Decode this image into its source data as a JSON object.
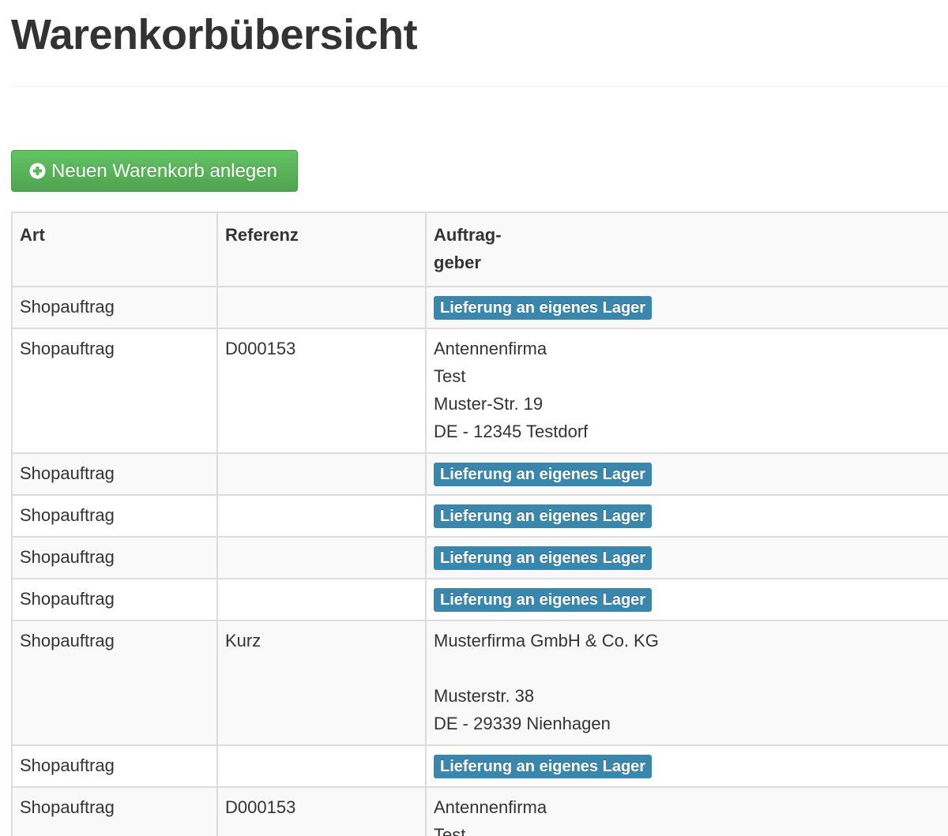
{
  "page": {
    "title": "Warenkorbübersicht"
  },
  "toolbar": {
    "new_cart_label": "Neuen Warenkorb anlegen",
    "new_cart_icon": "plus-circle-icon"
  },
  "colors": {
    "success_button": "#5bb75b",
    "info_badge": "#3a87ad",
    "title_text": "#333333"
  },
  "table": {
    "headers": {
      "art": "Art",
      "referenz": "Referenz",
      "auftrag_line1": "Auftrag-",
      "auftrag_line2": "geber"
    },
    "rows": [
      {
        "art": "Shopauftrag",
        "referenz": "",
        "badge": "Lieferung an eigenes Lager"
      },
      {
        "art": "Shopauftrag",
        "referenz": "D000153",
        "address": [
          "Antennenfirma",
          "Test",
          "Muster-Str. 19",
          "DE - 12345 Testdorf"
        ]
      },
      {
        "art": "Shopauftrag",
        "referenz": "",
        "badge": "Lieferung an eigenes Lager"
      },
      {
        "art": "Shopauftrag",
        "referenz": "",
        "badge": "Lieferung an eigenes Lager"
      },
      {
        "art": "Shopauftrag",
        "referenz": "",
        "badge": "Lieferung an eigenes Lager"
      },
      {
        "art": "Shopauftrag",
        "referenz": "",
        "badge": "Lieferung an eigenes Lager"
      },
      {
        "art": "Shopauftrag",
        "referenz": "Kurz",
        "address": [
          "Musterfirma GmbH & Co. KG",
          "",
          "Musterstr. 38",
          "DE - 29339 Nienhagen"
        ]
      },
      {
        "art": "Shopauftrag",
        "referenz": "",
        "badge": "Lieferung an eigenes Lager"
      },
      {
        "art": "Shopauftrag",
        "referenz": "D000153",
        "address": [
          "Antennenfirma",
          "Test"
        ]
      }
    ]
  }
}
